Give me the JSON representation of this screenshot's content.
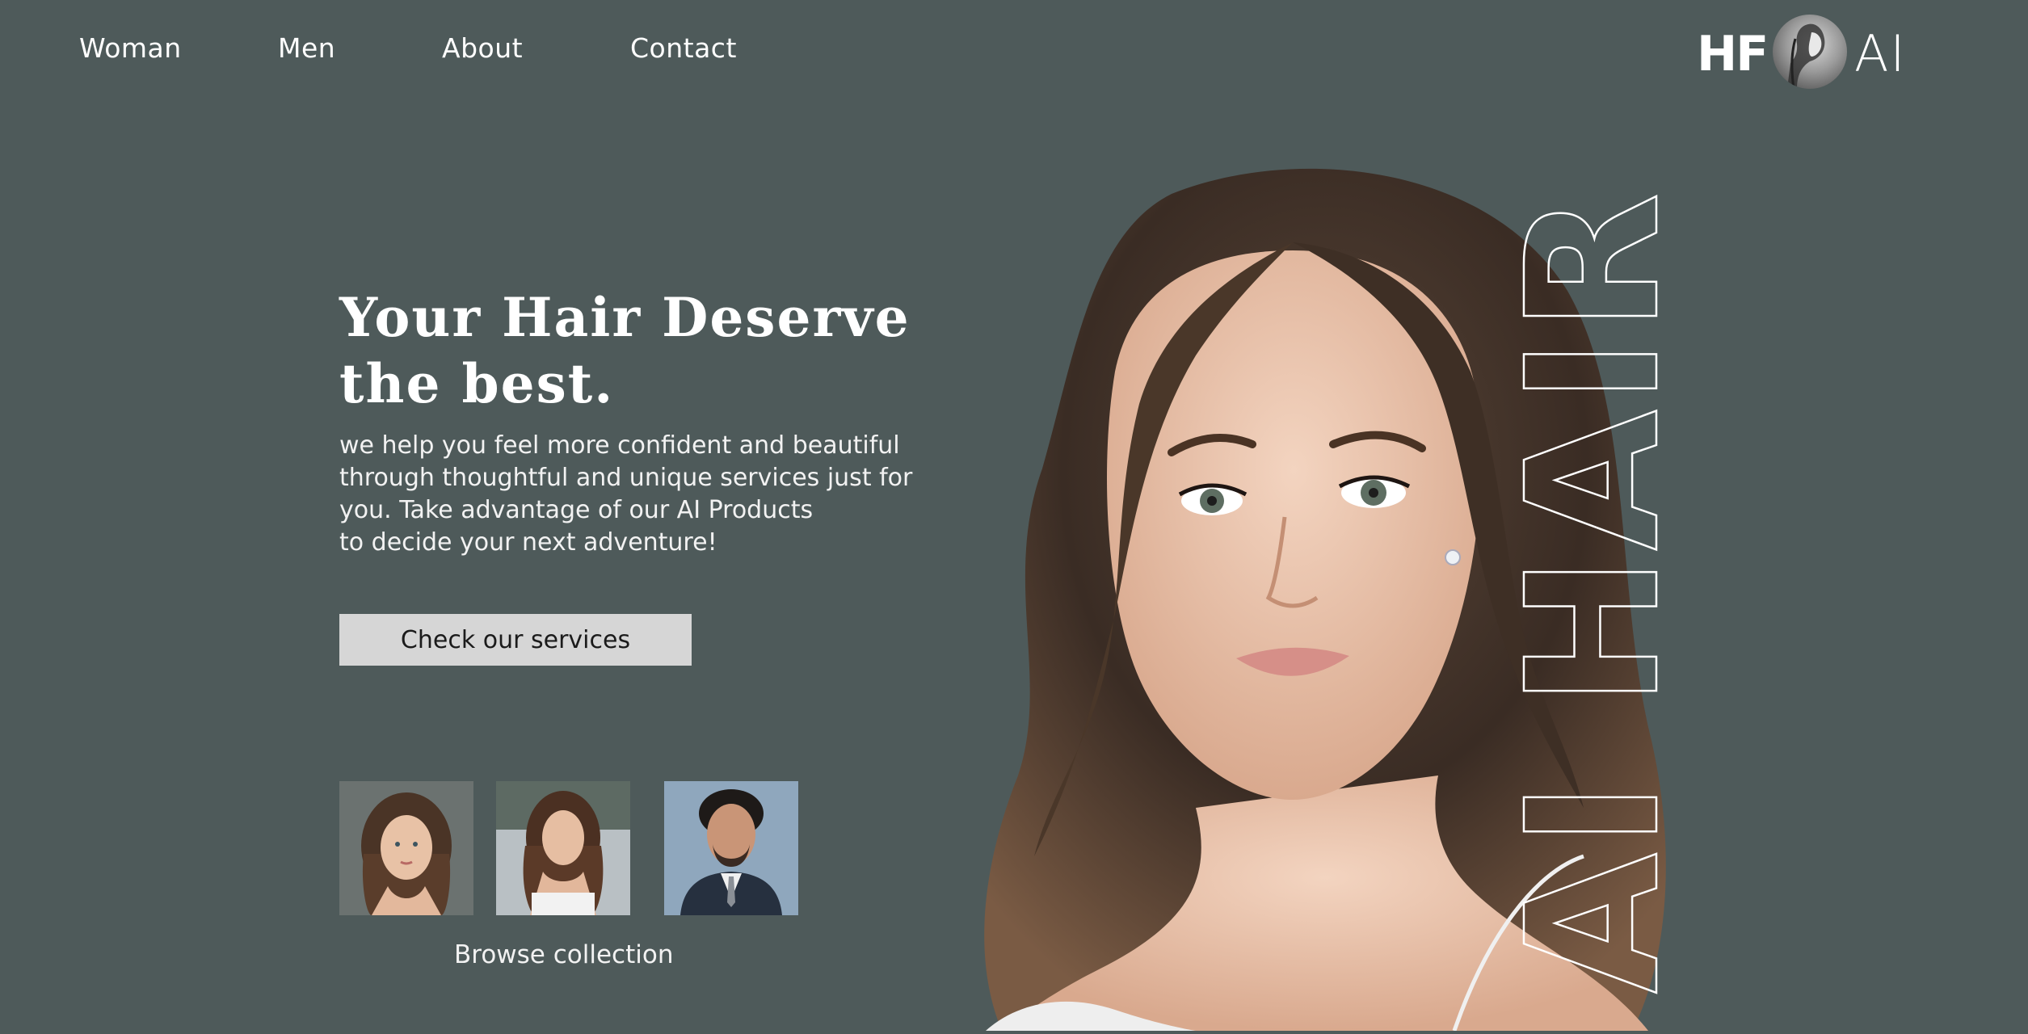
{
  "nav": {
    "items": [
      {
        "label": "Woman"
      },
      {
        "label": "Men"
      },
      {
        "label": "About"
      },
      {
        "label": "Contact"
      }
    ]
  },
  "logo": {
    "left_text": "HF",
    "right_text": "AI"
  },
  "hero": {
    "title_line1": "Your Hair Deserve",
    "title_line2": "the best.",
    "subtitle_lines": [
      "we help you feel more confident and beautiful",
      "through thoughtful and unique services just for",
      "you. Take advantage of our AI Products",
      "to decide your next adventure!"
    ],
    "cta_label": "Check our services",
    "vertical_text": "AI HAIR"
  },
  "collection": {
    "browse_label": "Browse collection"
  },
  "colors": {
    "background": "#4e5a5a",
    "cta_background": "#d6d6d6",
    "text": "#ffffff"
  }
}
